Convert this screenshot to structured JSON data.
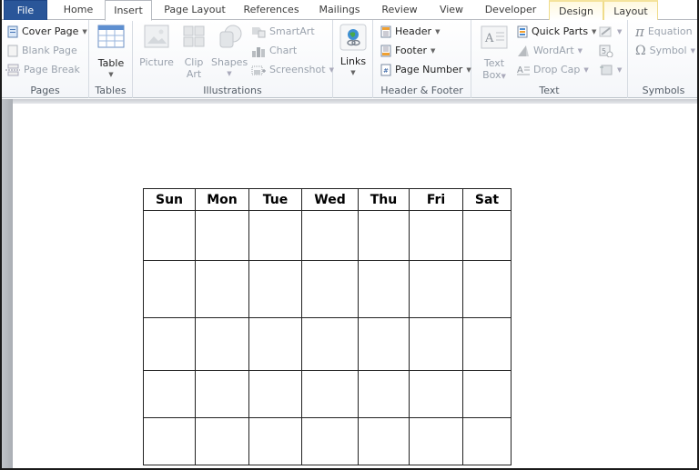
{
  "tabs": [
    {
      "id": "file",
      "label": "File"
    },
    {
      "id": "home",
      "label": "Home"
    },
    {
      "id": "insert",
      "label": "Insert",
      "active": true
    },
    {
      "id": "page-layout",
      "label": "Page Layout"
    },
    {
      "id": "references",
      "label": "References"
    },
    {
      "id": "mailings",
      "label": "Mailings"
    },
    {
      "id": "review",
      "label": "Review"
    },
    {
      "id": "view",
      "label": "View"
    },
    {
      "id": "developer",
      "label": "Developer"
    },
    {
      "id": "design",
      "label": "Design",
      "contextual": true
    },
    {
      "id": "layout",
      "label": "Layout",
      "contextual": true
    }
  ],
  "ribbon": {
    "pages": {
      "label": "Pages",
      "cover_page": "Cover Page",
      "blank_page": "Blank Page",
      "page_break": "Page Break"
    },
    "tables": {
      "label": "Tables",
      "table": "Table"
    },
    "illustrations": {
      "label": "Illustrations",
      "picture": "Picture",
      "clip_art_1": "Clip",
      "clip_art_2": "Art",
      "shapes": "Shapes",
      "smartart": "SmartArt",
      "chart": "Chart",
      "screenshot": "Screenshot"
    },
    "links": {
      "links": "Links"
    },
    "header_footer": {
      "label": "Header & Footer",
      "header": "Header",
      "footer": "Footer",
      "page_number": "Page Number"
    },
    "text": {
      "label": "Text",
      "text_box_1": "Text",
      "text_box_2": "Box",
      "quick_parts": "Quick Parts",
      "wordart": "WordArt",
      "drop_cap": "Drop Cap"
    },
    "symbols": {
      "label": "Symbols",
      "equation": "Equation",
      "symbol": "Symbol",
      "equation_glyph": "π",
      "symbol_glyph": "Ω"
    }
  },
  "document": {
    "calendar": {
      "days": [
        "Sun",
        "Mon",
        "Tue",
        "Wed",
        "Thu",
        "Fri",
        "Sat"
      ],
      "rows": 5
    }
  },
  "colors": {
    "file_tab": "#2a5699",
    "contextual_tab": "#f4e39c"
  }
}
